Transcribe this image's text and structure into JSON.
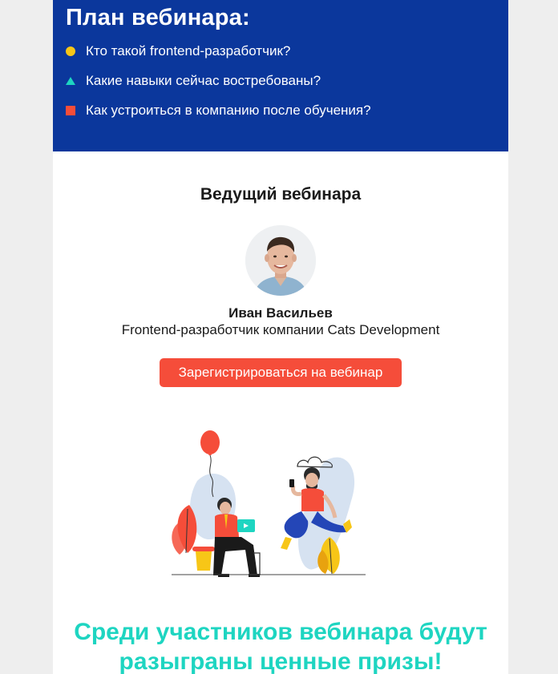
{
  "plan": {
    "title": "План вебинара:",
    "items": [
      {
        "marker": "circle",
        "color": "#f7c617",
        "text": "Кто такой frontend-разработчик?"
      },
      {
        "marker": "triangle",
        "color": "#1ed5c1",
        "text": "Какие навыки сейчас востребованы?"
      },
      {
        "marker": "square",
        "color": "#f54d3a",
        "text": "Как устроиться в компанию после обучения?"
      }
    ],
    "background_color": "#0b379c"
  },
  "host": {
    "section_title": "Ведущий вебинара",
    "avatar_icon": "speaker-photo",
    "name": "Иван Васильев",
    "role": "Frontend-разработчик компании Cats Development"
  },
  "cta": {
    "label": "Зарегистрироваться на вебинар",
    "color": "#f54d3a"
  },
  "illustration": {
    "icon": "people-celebrating-illustration"
  },
  "prize": {
    "line1": "Среди участников вебинара будут",
    "line2": "разыграны ценные призы!",
    "color": "#1ed5c1"
  }
}
